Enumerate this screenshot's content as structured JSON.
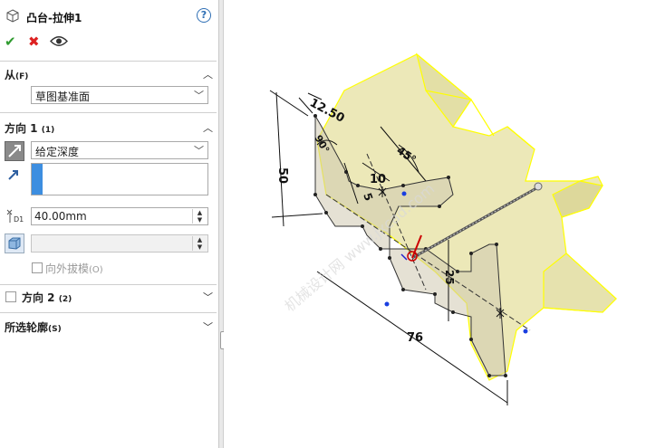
{
  "feature": {
    "title": "凸台-拉伸1"
  },
  "help": {
    "label": "?"
  },
  "from": {
    "title": "从",
    "hotkey": "(F)",
    "value": "草图基准面"
  },
  "direction1": {
    "title": "方向 1",
    "hotkey": "(1)",
    "end_condition": "给定深度",
    "depth": "40.00mm",
    "draft_label": "向外拔模",
    "draft_hotkey": "(O)"
  },
  "direction2": {
    "title": "方向 2",
    "hotkey": "(2)"
  },
  "contours": {
    "title": "所选轮廓",
    "hotkey": "(S)"
  },
  "dimensions": [
    "12.50",
    "45°",
    "10",
    "5",
    "50",
    "90°",
    "25",
    "76"
  ],
  "watermark": "机械设计网 www.jxcad.com",
  "colors": {
    "accent": "#3d8ee0",
    "model_face": "#e8e4b0",
    "highlight_edge": "#ffff00",
    "ok": "#2f9b2f",
    "cancel": "#dd2222"
  }
}
